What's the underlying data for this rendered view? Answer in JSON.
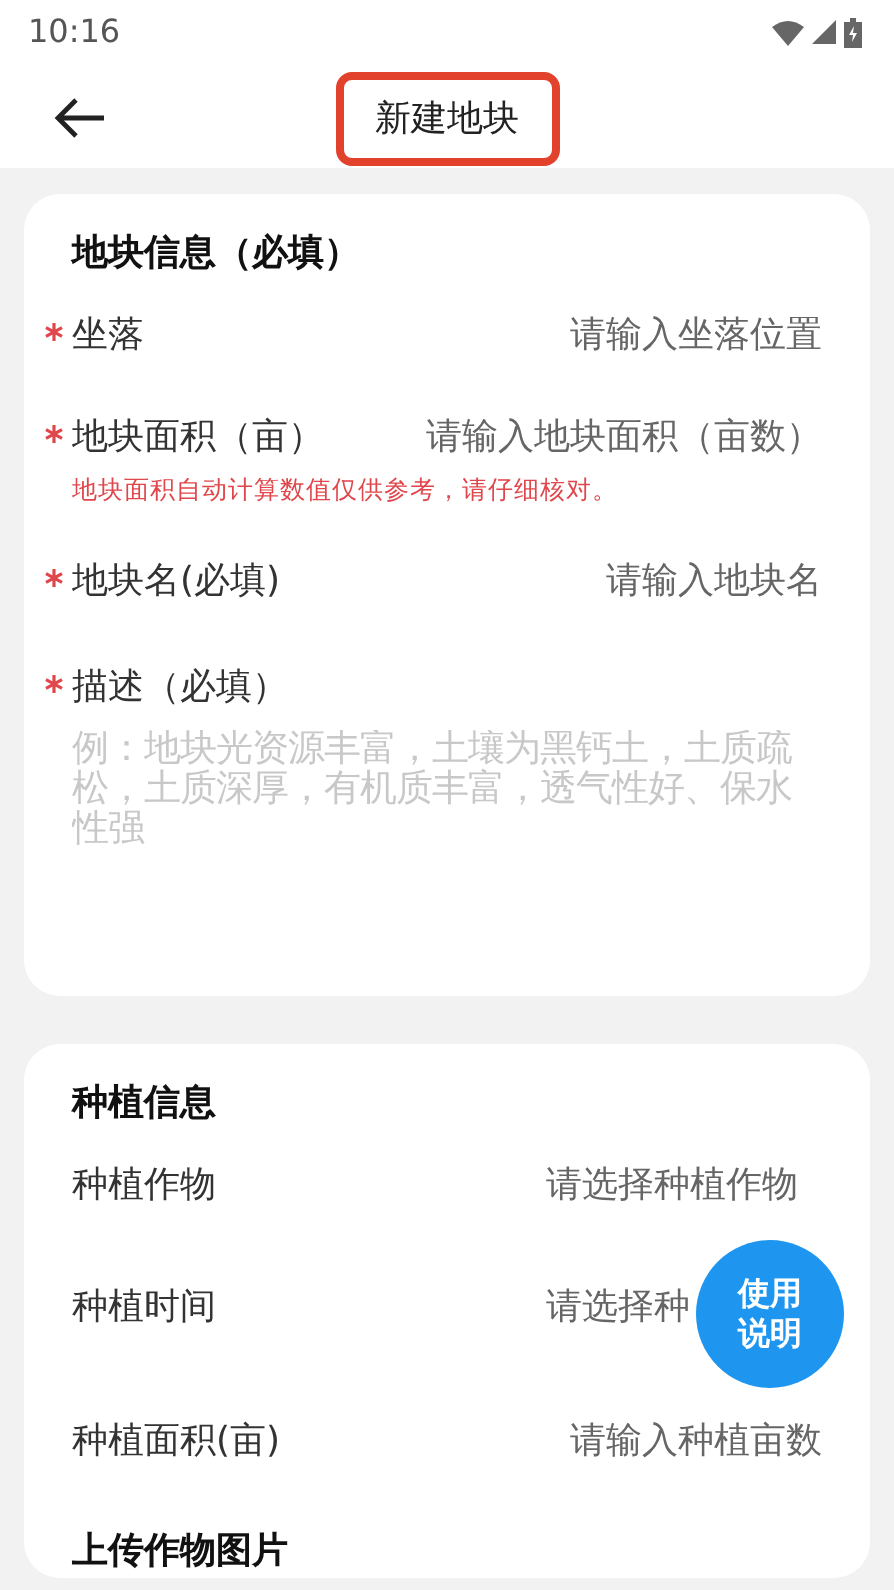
{
  "status_bar": {
    "time": "10:16"
  },
  "header": {
    "title": "新建地块",
    "title_highlighted": true
  },
  "sections": [
    {
      "title": "地块信息（必填）",
      "fields": [
        {
          "kind": "input",
          "label": "坐落",
          "required": true,
          "placeholder": "请输入坐落位置"
        },
        {
          "kind": "input",
          "label": "地块面积（亩）",
          "required": true,
          "placeholder": "请输入地块面积（亩数）",
          "hint": "地块面积自动计算数值仅供参考，请仔细核对。"
        },
        {
          "kind": "input",
          "label": "地块名(必填)",
          "required": true,
          "placeholder": "请输入地块名"
        },
        {
          "kind": "textarea",
          "label": "描述（必填）",
          "required": true,
          "placeholder": "例：地块光资源丰富，土壤为黑钙土，土质疏松，土质深厚，有机质丰富，透气性好、保水性强"
        }
      ]
    },
    {
      "title": "种植信息",
      "fields": [
        {
          "kind": "select",
          "label": "种植作物",
          "required": false,
          "placeholder": "请选择种植作物"
        },
        {
          "kind": "select",
          "label": "种植时间",
          "required": false,
          "placeholder": "请选择种"
        },
        {
          "kind": "input",
          "label": "种植面积(亩)",
          "required": false,
          "placeholder": "请输入种植亩数"
        }
      ],
      "next_heading": "上传作物图片"
    }
  ],
  "help_button": {
    "label": "使用说明"
  }
}
